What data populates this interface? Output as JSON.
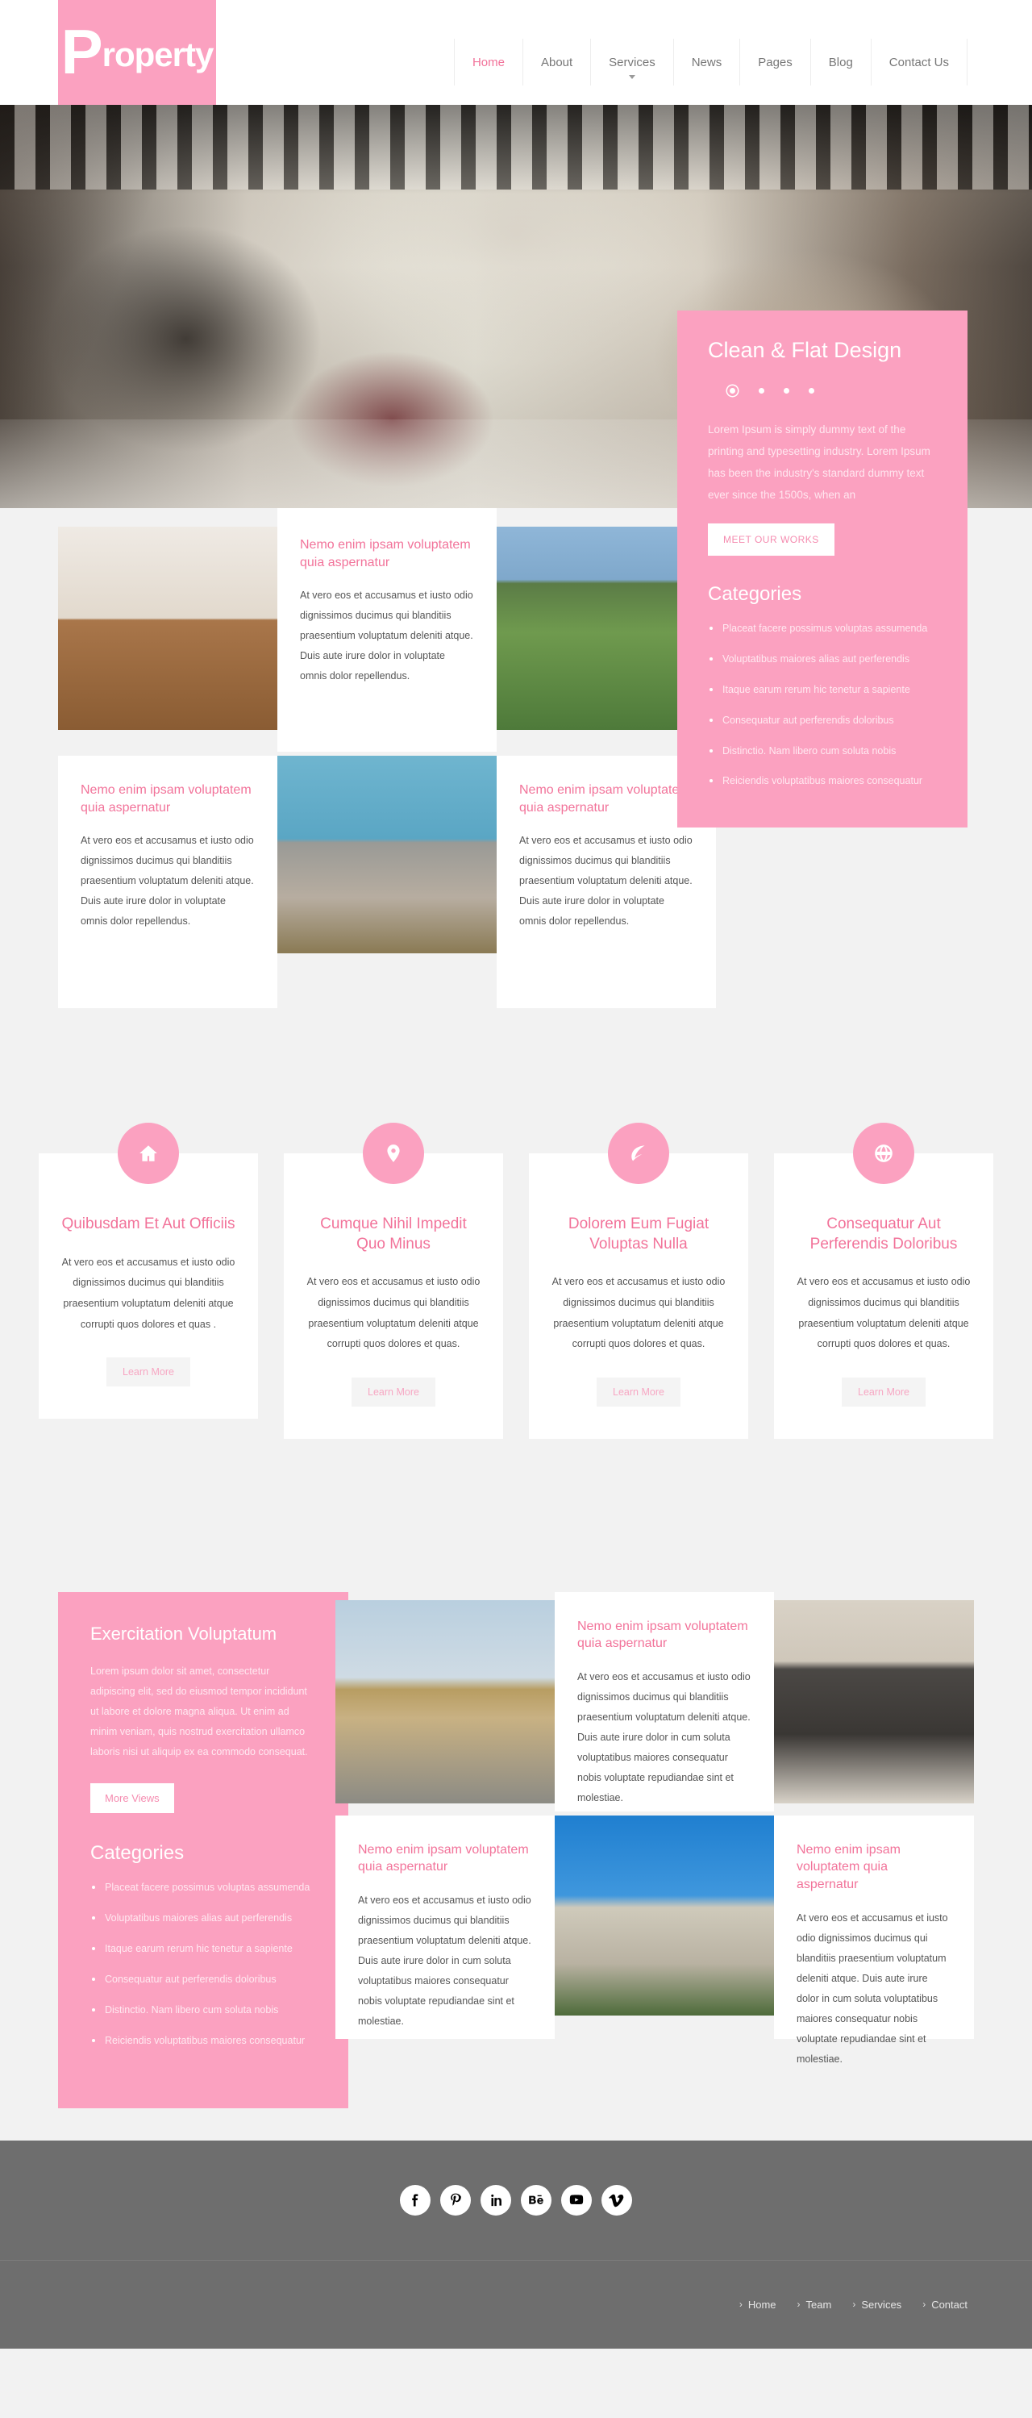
{
  "colors": {
    "pink": "#fba1c0",
    "pink_text": "#f2739a",
    "footer_gray": "#6e6e6e",
    "page_bg": "#f2f2f2"
  },
  "header": {
    "logo_first": "P",
    "logo_rest": "roperty",
    "nav": [
      {
        "label": "Home",
        "active": true,
        "caret": false
      },
      {
        "label": "About",
        "active": false,
        "caret": false
      },
      {
        "label": "Services",
        "active": false,
        "caret": true
      },
      {
        "label": "News",
        "active": false,
        "caret": false
      },
      {
        "label": "Pages",
        "active": false,
        "caret": false
      },
      {
        "label": "Blog",
        "active": false,
        "caret": false
      },
      {
        "label": "Contact Us",
        "active": false,
        "caret": false
      }
    ]
  },
  "hero": {
    "title": "Clean & Flat Design",
    "text": "Lorem Ipsum is simply dummy text of the printing and typesetting industry. Lorem Ipsum has been the industry's standard dummy text ever since the 1500s, when an",
    "button": "MEET OUR WORKS",
    "dots": 4,
    "active_dot": 0
  },
  "sidebar": {
    "categories_title": "Categories",
    "categories": [
      "Placeat facere possimus voluptas assumenda",
      "Voluptatibus maiores alias aut perferendis",
      "Itaque earum rerum hic tenetur a sapiente",
      "Consequatur aut perferendis doloribus",
      "Distinctio. Nam libero cum soluta nobis",
      "Reiciendis voluptatibus maiores consequatur"
    ]
  },
  "features": {
    "heading": "Nemo enim ipsam voluptatem quia aspernatur",
    "body": "At vero eos et accusamus et iusto odio dignissimos ducimus qui blanditiis praesentium voluptatum deleniti atque. Duis aute irure dolor in voluptate omnis dolor repellendus.",
    "blocks": [
      {
        "heading": "Nemo enim ipsam voluptatem quia aspernatur",
        "body": "At vero eos et accusamus et iusto odio dignissimos ducimus qui blanditiis praesentium voluptatum deleniti atque. Duis aute irure dolor in voluptate omnis dolor repellendus."
      },
      {
        "heading": "Nemo enim ipsam voluptatem quia aspernatur",
        "body": "At vero eos et accusamus et iusto odio dignissimos ducimus qui blanditiis praesentium voluptatum deleniti atque. Duis aute irure dolor in voluptate omnis dolor repellendus."
      },
      {
        "heading": "Nemo enim ipsam voluptatem quia aspernatur",
        "body": "At vero eos et accusamus et iusto odio dignissimos ducimus qui blanditiis praesentium voluptatum deleniti atque. Duis aute irure dolor in voluptate omnis dolor repellendus."
      }
    ]
  },
  "services": [
    {
      "icon": "home-icon",
      "title": "Quibusdam Et Aut Officiis",
      "body": "At vero eos et accusamus et iusto odio dignissimos ducimus qui blanditiis praesentium voluptatum deleniti atque corrupti quos dolores et quas .",
      "button": "Learn More"
    },
    {
      "icon": "map-pin-icon",
      "title": "Cumque Nihil Impedit Quo Minus",
      "body": "At vero eos et accusamus et iusto odio dignissimos ducimus qui blanditiis praesentium voluptatum deleniti atque corrupti quos dolores et quas.",
      "button": "Learn More"
    },
    {
      "icon": "leaf-icon",
      "title": "Dolorem Eum Fugiat Voluptas Nulla",
      "body": "At vero eos et accusamus et iusto odio dignissimos ducimus qui blanditiis praesentium voluptatum deleniti atque corrupti quos dolores et quas.",
      "button": "Learn More"
    },
    {
      "icon": "globe-icon",
      "title": "Consequatur Aut Perferendis Doloribus",
      "body": "At vero eos et accusamus et iusto odio dignissimos ducimus qui blanditiis praesentium voluptatum deleniti atque corrupti quos dolores et quas.",
      "button": "Learn More"
    }
  ],
  "gallery": {
    "panel_title": "Exercitation Voluptatum",
    "panel_text": "Lorem ipsum dolor sit amet, consectetur adipiscing elit, sed do eiusmod tempor incididunt ut labore et dolore magna aliqua. Ut enim ad minim veniam, quis nostrud exercitation ullamco laboris nisi ut aliquip ex ea commodo consequat.",
    "panel_button": "More Views",
    "categories_title": "Categories",
    "categories": [
      "Placeat facere possimus voluptas assumenda",
      "Voluptatibus maiores alias aut perferendis",
      "Itaque earum rerum hic tenetur a sapiente",
      "Consequatur aut perferendis doloribus",
      "Distinctio. Nam libero cum soluta nobis",
      "Reiciendis voluptatibus maiores consequatur"
    ],
    "blocks": [
      {
        "heading": "Nemo enim ipsam voluptatem quia aspernatur",
        "body": "At vero eos et accusamus et iusto odio dignissimos ducimus qui blanditiis praesentium voluptatum deleniti atque. Duis aute irure dolor in cum soluta voluptatibus maiores consequatur nobis voluptate repudiandae sint et molestiae."
      },
      {
        "heading": "Nemo enim ipsam voluptatem quia aspernatur",
        "body": "At vero eos et accusamus et iusto odio dignissimos ducimus qui blanditiis praesentium voluptatum deleniti atque. Duis aute irure dolor in cum soluta voluptatibus maiores consequatur nobis voluptate repudiandae sint et molestiae."
      },
      {
        "heading": "Nemo enim ipsam voluptatem quia aspernatur",
        "body": "At vero eos et accusamus et iusto odio dignissimos ducimus qui blanditiis praesentium voluptatum deleniti atque. Duis aute irure dolor in cum soluta voluptatibus maiores consequatur nobis voluptate repudiandae sint et molestiae."
      }
    ]
  },
  "footer": {
    "social": [
      {
        "name": "facebook-icon",
        "glyph": "f"
      },
      {
        "name": "pinterest-icon",
        "glyph": "P"
      },
      {
        "name": "linkedin-icon",
        "glyph": "in"
      },
      {
        "name": "behance-icon",
        "glyph": "Bē"
      },
      {
        "name": "youtube-icon",
        "glyph": "You"
      },
      {
        "name": "vimeo-icon",
        "glyph": "v"
      }
    ],
    "links": [
      {
        "chev": "›",
        "label": "Home"
      },
      {
        "chev": "›",
        "label": "Team"
      },
      {
        "chev": "›",
        "label": "Services"
      },
      {
        "chev": "›",
        "label": "Contact"
      }
    ]
  }
}
